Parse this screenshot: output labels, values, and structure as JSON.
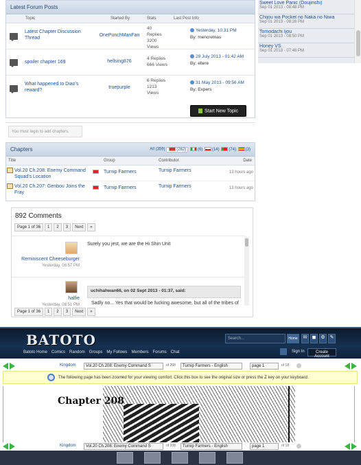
{
  "right_column": {
    "items": [
      {
        "title": "Sweet Love Panic (Doujinshi)",
        "date": "Sep 01 2013 - 08:48 PM"
      },
      {
        "title": "Chijou wa Pocket no Naka no Niwa",
        "date": "Sep 01 2013 - 08:28 PM"
      },
      {
        "title": "Tomodachi Ijou",
        "date": "Sep 01 2013 - 08:50 PM"
      },
      {
        "title": "Honey VS",
        "date": "Sep 01 2013 - 07:48 PM"
      }
    ]
  },
  "forum": {
    "title": "Latest Forum Posts",
    "columns": {
      "topic": "Topic",
      "started_by": "Started By",
      "stats": "Stats",
      "last_post": "Last Post Info"
    },
    "rows": [
      {
        "title": "Latest Chapter Discussion Thread",
        "starter": "OnePunchManFan",
        "replies": "40",
        "replies_label": "Replies",
        "views": "3200",
        "views_label": "Views",
        "last_date": "Yesterday, 10:31 PM",
        "last_by": "By: mencretnas"
      },
      {
        "title": "spoiler chapter 169",
        "starter": "hellsing876",
        "replies": "4 Replies",
        "replies_label": "",
        "views": "666 Views",
        "views_label": "",
        "last_date": "29 July 2013 - 01:42 AM",
        "last_by": "By: ellere"
      },
      {
        "title": "What happened to Diao's reward?",
        "starter": "truepurple",
        "replies": "6 Replies",
        "replies_label": "",
        "views": "1213",
        "views_label": "Views",
        "last_date": "31 May 2013 - 09:56 AM",
        "last_by": "By: Expers"
      }
    ],
    "new_topic": "Start New Topic"
  },
  "login_notice": "You must login to add chapters.",
  "chapters": {
    "title": "Chapters",
    "langs": {
      "all": "All (359)",
      "en": "(262)",
      "it": "(6)",
      "pl": "(14)",
      "pt": "(74)",
      "es": "(3)"
    },
    "columns": {
      "title": "Title",
      "group": "Group",
      "contributor": "Contributor",
      "date": "Date"
    },
    "rows": [
      {
        "title": "Vol.20 Ch.208: Enemy Command Squad's Location",
        "group": "Turnip Farmers",
        "contributor": "Turnip Farmers",
        "date": "13 hours ago"
      },
      {
        "title": "Vol.20 Ch.207: Genbou Joins the Fray",
        "group": "Turnip Farmers",
        "contributor": "Turnip Farmers",
        "date": "13 hours ago"
      }
    ]
  },
  "comments": {
    "count_label": "892 Comments",
    "pagination": {
      "page": "Page 1 of 36",
      "p1": "1",
      "p2": "2",
      "p3": "3",
      "next": "Next",
      "last": "»"
    },
    "items": [
      {
        "user": "Reminiscent Cheeseburger",
        "date": "Yesterday, 08:57 PM",
        "text": "Surely you jest, we are the Hi Shin Unit"
      },
      {
        "user": "halfie",
        "date": "Yesterday, 08:51 PM",
        "quote": "uchihahwan66, on 02 Sept 2013 - 01:37, said:",
        "text": "Sadly no... Yes that would be fucking awesome, but all of the tribes of"
      }
    ]
  },
  "site": {
    "logo": "BATOTO",
    "search_placeholder": "Search...",
    "home": "Home",
    "nav": [
      "Batoto Home",
      "Comics",
      "Random",
      "Groups",
      "My Follows",
      "Members",
      "Forums",
      "Chat"
    ],
    "sign_in": "Sign In",
    "create_account": "Create Account"
  },
  "reader": {
    "kingdom": "Kingdom",
    "chapter_select": "Vol.20 Ch.208: Enemy Command S",
    "of_chapters": "of 208",
    "group_select": "Turnip Farmers - English",
    "page_select": "page 1",
    "of_pages": "of 18",
    "zoom_notice": "The following page has been zoomed for your viewing comfort. Click this box to see the original size or press the Z key on your keyboard.",
    "manga_title": "Chapter 208"
  },
  "colors": {
    "accent": "#1f4f8f",
    "nav_bg": "#163252",
    "arrow_green": "#3bb54a",
    "zoom_bg": "#ffffcf"
  }
}
